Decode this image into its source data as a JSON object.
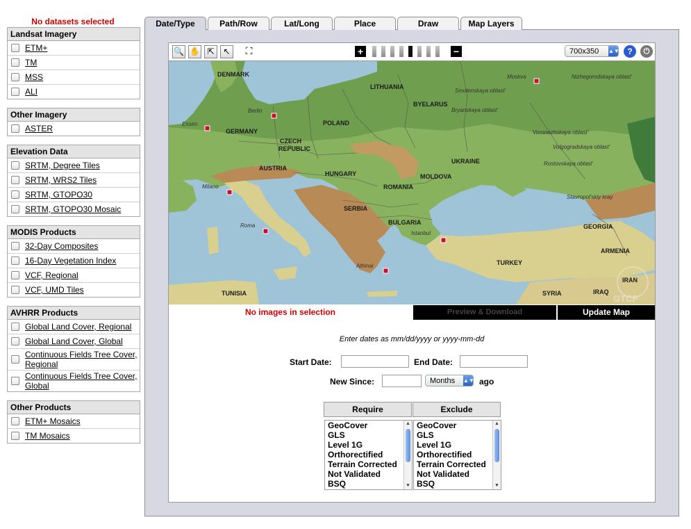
{
  "status": "No datasets selected",
  "groups": [
    {
      "title": "Landsat Imagery",
      "items": [
        "ETM+",
        "TM",
        "MSS",
        "ALI"
      ]
    },
    {
      "title": "Other Imagery",
      "items": [
        "ASTER"
      ]
    },
    {
      "title": "Elevation Data",
      "items": [
        "SRTM, Degree Tiles",
        "SRTM, WRS2 Tiles",
        "SRTM, GTOPO30",
        "SRTM, GTOPO30 Mosaic"
      ]
    },
    {
      "title": "MODIS Products",
      "items": [
        "32-Day Composites",
        "16-Day Vegetation Index",
        "VCF, Regional",
        "VCF, UMD Tiles"
      ]
    },
    {
      "title": "AVHRR Products",
      "items": [
        "Global Land Cover, Regional",
        "Global Land Cover, Global",
        "Continuous Fields Tree Cover, Regional",
        "Continuous Fields Tree Cover, Global"
      ]
    },
    {
      "title": "Other Products",
      "items": [
        "ETM+ Mosaics",
        "TM Mosaics"
      ]
    }
  ],
  "tabs": [
    "Date/Type",
    "Path/Row",
    "Lat/Long",
    "Place",
    "Draw",
    "Map Layers"
  ],
  "toolbar": {
    "icons": [
      "magnifier-icon",
      "hand-pan-icon",
      "select-arrow-plus-icon",
      "select-arrow-icon",
      "fullscreen-icon"
    ],
    "zoom_in": "+",
    "zoom_out": "−",
    "zoom_levels": 8,
    "zoom_selected": 5,
    "map_size": "700x350",
    "help": "?",
    "power": "⏻"
  },
  "map": {
    "countries": [
      "DENMARK",
      "LITHUANIA",
      "BYELARUS",
      "POLAND",
      "GERMANY",
      "CZECH",
      "REPUBLIC",
      "AUSTRIA",
      "HUNGARY",
      "UKRAINE",
      "MOLDOVA",
      "ROMANIA",
      "SERBIA",
      "BULGARIA",
      "GEORGIA",
      "ARMENIA",
      "TURKEY",
      "IRAN",
      "IRAQ",
      "SYRIA",
      "TUNISIA"
    ],
    "cities": [
      "Moskva",
      "Berlin",
      "Essen",
      "Milano",
      "Roma",
      "Istanbul",
      "Athinai"
    ],
    "regions": [
      "Nizhegorodskaya oblast'",
      "Smolenskaya oblast'",
      "Bryanskaya oblast'",
      "Voronezhskaya oblast'",
      "Volgogradskaya oblast'",
      "Rostovskaya oblast'",
      "Stavropol'skiy kray"
    ],
    "watermark": "GTCF",
    "colors": {
      "sea": "#9fc4d8",
      "lowland": "#6f9f4e",
      "plain": "#88b25d",
      "upland": "#d9cf8e",
      "mountain": "#b88a55",
      "marker": "#c8102e"
    }
  },
  "map_footer": {
    "no_images": "No images in selection",
    "preview": "Preview & Download",
    "update": "Update Map"
  },
  "form": {
    "hint": "Enter dates as mm/dd/yyyy or yyyy-mm-dd",
    "start_label": "Start Date:",
    "start_value": "",
    "end_label": "End Date:",
    "end_value": "",
    "since_label": "New Since:",
    "since_value": "",
    "since_unit": "Months",
    "ago": "ago",
    "require_header": "Require",
    "exclude_header": "Exclude",
    "options": [
      "GeoCover",
      "GLS",
      "Level 1G",
      "Orthorectified",
      "Terrain Corrected",
      "Not Validated",
      "BSQ"
    ]
  }
}
